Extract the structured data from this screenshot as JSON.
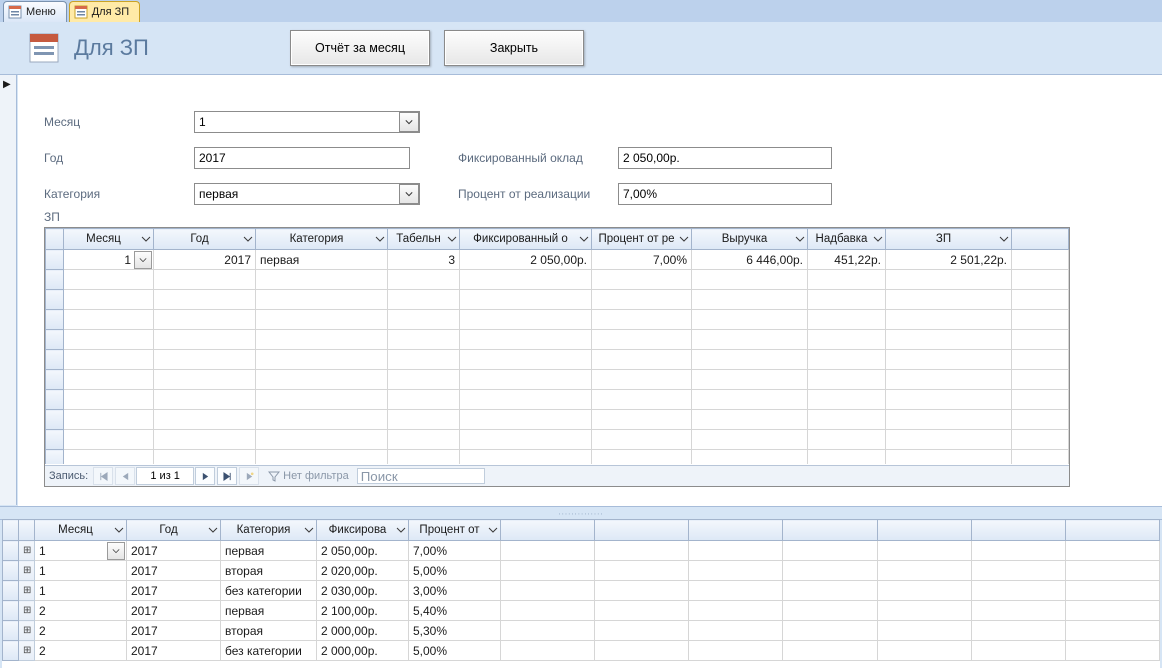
{
  "tabs": {
    "menu": "Меню",
    "zp": "Для ЗП"
  },
  "header": {
    "title": "Для ЗП",
    "report_btn": "Отчёт за месяц",
    "close_btn": "Закрыть"
  },
  "form": {
    "month_label": "Месяц",
    "month_value": "1",
    "year_label": "Год",
    "year_value": "2017",
    "category_label": "Категория",
    "category_value": "первая",
    "fixed_label": "Фиксированный оклад",
    "fixed_value": "2 050,00р.",
    "percent_label": "Процент от реализации",
    "percent_value": "7,00%",
    "sub_label": "ЗП"
  },
  "sub1": {
    "headers": [
      "Месяц",
      "Год",
      "Категория",
      "Табельн",
      "Фиксированный о",
      "Процент от ре",
      "Выручка",
      "Надбавка",
      "ЗП"
    ],
    "row": {
      "month": "1",
      "year": "2017",
      "category": "первая",
      "tabel": "3",
      "fixed": "2 050,00р.",
      "percent": "7,00%",
      "revenue": "6 446,00р.",
      "bonus": "451,22р.",
      "zp": "2 501,22р."
    },
    "nav": {
      "label": "Запись:",
      "pos": "1 из 1",
      "nofilter": "Нет фильтра",
      "search": "Поиск"
    }
  },
  "sheet2": {
    "headers": [
      "Месяц",
      "Год",
      "Категория",
      "Фиксирова",
      "Процент от"
    ],
    "rows": [
      {
        "month": "1",
        "year": "2017",
        "category": "первая",
        "fixed": "2 050,00р.",
        "percent": "7,00%",
        "sel": true
      },
      {
        "month": "1",
        "year": "2017",
        "category": "вторая",
        "fixed": "2 020,00р.",
        "percent": "5,00%"
      },
      {
        "month": "1",
        "year": "2017",
        "category": "без категории",
        "fixed": "2 030,00р.",
        "percent": "3,00%"
      },
      {
        "month": "2",
        "year": "2017",
        "category": "первая",
        "fixed": "2 100,00р.",
        "percent": "5,40%"
      },
      {
        "month": "2",
        "year": "2017",
        "category": "вторая",
        "fixed": "2 000,00р.",
        "percent": "5,30%"
      },
      {
        "month": "2",
        "year": "2017",
        "category": "без категории",
        "fixed": "2 000,00р.",
        "percent": "5,00%"
      }
    ]
  }
}
